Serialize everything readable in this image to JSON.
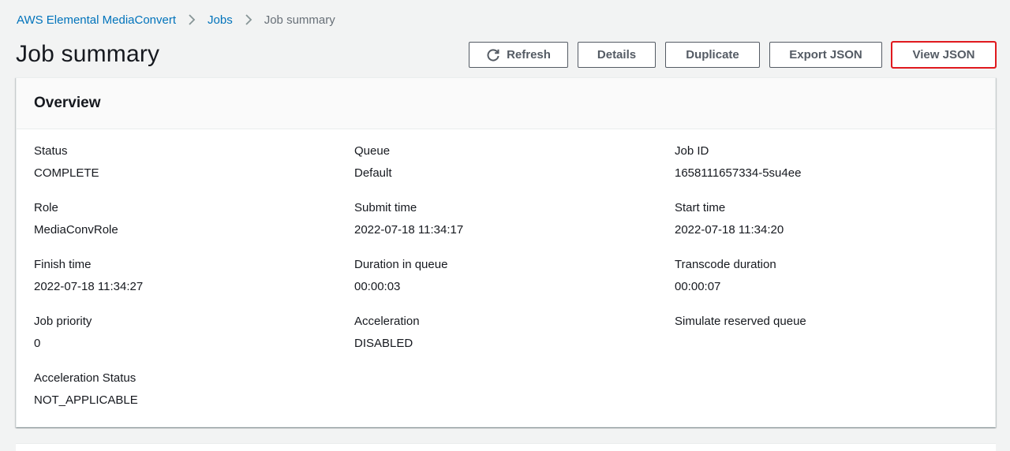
{
  "breadcrumb": {
    "service": "AWS Elemental MediaConvert",
    "jobs": "Jobs",
    "current": "Job summary"
  },
  "page": {
    "title": "Job summary"
  },
  "actions": {
    "refresh": "Refresh",
    "details": "Details",
    "duplicate": "Duplicate",
    "export_json": "Export JSON",
    "view_json": "View JSON"
  },
  "overview": {
    "title": "Overview",
    "fields": [
      {
        "label": "Status",
        "value": "COMPLETE"
      },
      {
        "label": "Queue",
        "value": "Default"
      },
      {
        "label": "Job ID",
        "value": "1658111657334-5su4ee"
      },
      {
        "label": "Role",
        "value": "MediaConvRole"
      },
      {
        "label": "Submit time",
        "value": "2022-07-18 11:34:17"
      },
      {
        "label": "Start time",
        "value": "2022-07-18 11:34:20"
      },
      {
        "label": "Finish time",
        "value": "2022-07-18 11:34:27"
      },
      {
        "label": "Duration in queue",
        "value": "00:00:03"
      },
      {
        "label": "Transcode duration",
        "value": "00:00:07"
      },
      {
        "label": "Job priority",
        "value": "0"
      },
      {
        "label": "Acceleration",
        "value": "DISABLED"
      },
      {
        "label": "Simulate reserved queue",
        "value": ""
      },
      {
        "label": "Acceleration Status",
        "value": "NOT_APPLICABLE"
      }
    ]
  },
  "colors": {
    "link": "#0073bb",
    "highlight": "#e0191e",
    "button_text": "#545b64"
  }
}
